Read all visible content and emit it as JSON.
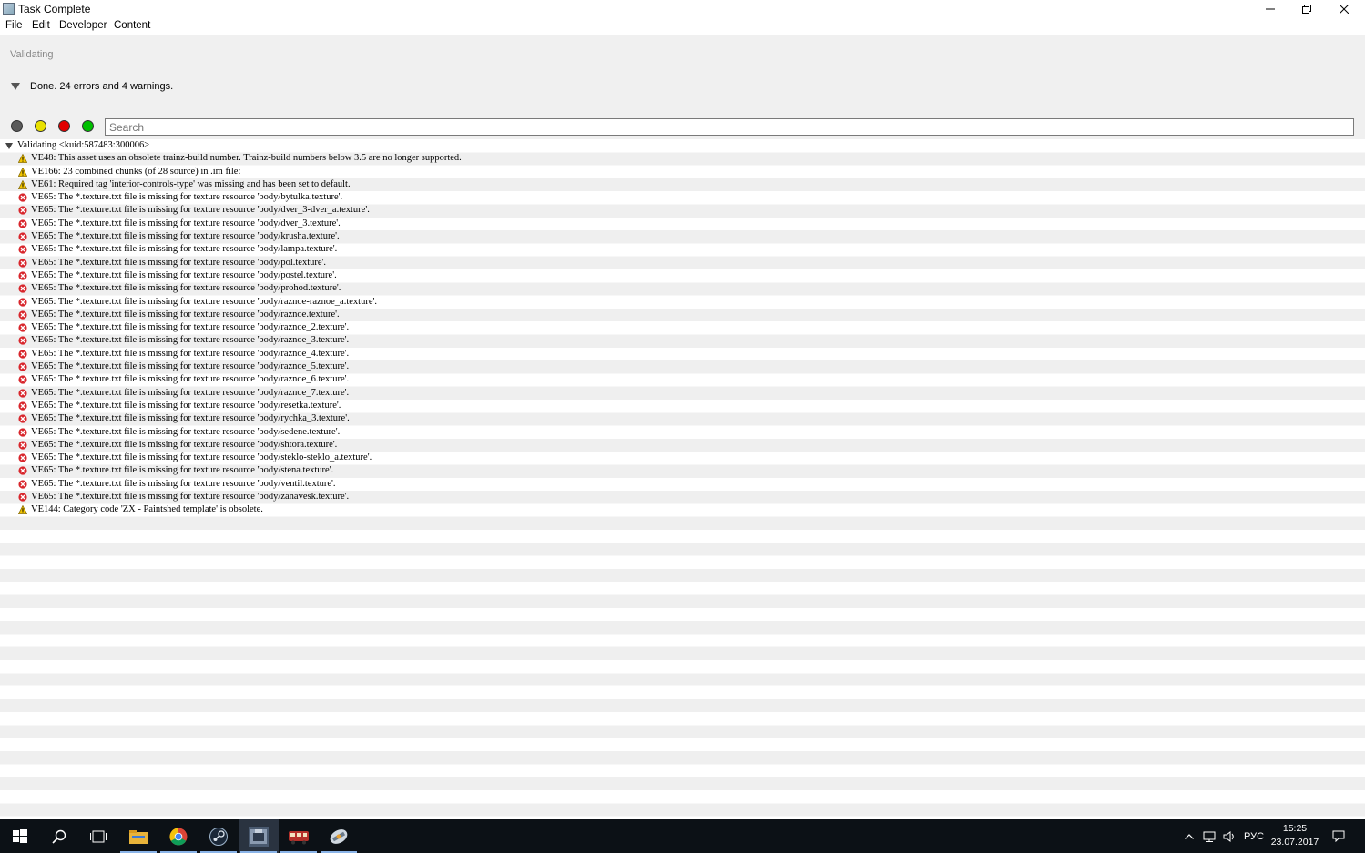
{
  "window": {
    "title": "Task Complete"
  },
  "menu": [
    "File",
    "Edit",
    "Developer",
    "Content"
  ],
  "panel": {
    "status": "Validating",
    "summary": "Done. 24 errors and 4 warnings."
  },
  "filters": [
    {
      "name": "all",
      "color": "#5a5a5a"
    },
    {
      "name": "warnings",
      "color": "#e8e000"
    },
    {
      "name": "errors",
      "color": "#e00000"
    },
    {
      "name": "ok",
      "color": "#00c000"
    }
  ],
  "search": {
    "placeholder": "Search"
  },
  "tree": {
    "root": "Validating <kuid:587483:300006>",
    "items": [
      {
        "level": "warning",
        "text": "VE48: This asset uses an obsolete trainz-build number. Trainz-build numbers below 3.5 are no longer supported."
      },
      {
        "level": "warning",
        "text": "VE166: 23 combined chunks (of 28 source) in .im file:"
      },
      {
        "level": "warning",
        "text": "VE61: Required tag 'interior-controls-type' was missing and has been set to default."
      },
      {
        "level": "error",
        "text": "VE65: The *.texture.txt file is missing for texture resource 'body/bytulka.texture'."
      },
      {
        "level": "error",
        "text": "VE65: The *.texture.txt file is missing for texture resource 'body/dver_3-dver_a.texture'."
      },
      {
        "level": "error",
        "text": "VE65: The *.texture.txt file is missing for texture resource 'body/dver_3.texture'."
      },
      {
        "level": "error",
        "text": "VE65: The *.texture.txt file is missing for texture resource 'body/krusha.texture'."
      },
      {
        "level": "error",
        "text": "VE65: The *.texture.txt file is missing for texture resource 'body/lampa.texture'."
      },
      {
        "level": "error",
        "text": "VE65: The *.texture.txt file is missing for texture resource 'body/pol.texture'."
      },
      {
        "level": "error",
        "text": "VE65: The *.texture.txt file is missing for texture resource 'body/postel.texture'."
      },
      {
        "level": "error",
        "text": "VE65: The *.texture.txt file is missing for texture resource 'body/prohod.texture'."
      },
      {
        "level": "error",
        "text": "VE65: The *.texture.txt file is missing for texture resource 'body/raznoe-raznoe_a.texture'."
      },
      {
        "level": "error",
        "text": "VE65: The *.texture.txt file is missing for texture resource 'body/raznoe.texture'."
      },
      {
        "level": "error",
        "text": "VE65: The *.texture.txt file is missing for texture resource 'body/raznoe_2.texture'."
      },
      {
        "level": "error",
        "text": "VE65: The *.texture.txt file is missing for texture resource 'body/raznoe_3.texture'."
      },
      {
        "level": "error",
        "text": "VE65: The *.texture.txt file is missing for texture resource 'body/raznoe_4.texture'."
      },
      {
        "level": "error",
        "text": "VE65: The *.texture.txt file is missing for texture resource 'body/raznoe_5.texture'."
      },
      {
        "level": "error",
        "text": "VE65: The *.texture.txt file is missing for texture resource 'body/raznoe_6.texture'."
      },
      {
        "level": "error",
        "text": "VE65: The *.texture.txt file is missing for texture resource 'body/raznoe_7.texture'."
      },
      {
        "level": "error",
        "text": "VE65: The *.texture.txt file is missing for texture resource 'body/resetka.texture'."
      },
      {
        "level": "error",
        "text": "VE65: The *.texture.txt file is missing for texture resource 'body/rychka_3.texture'."
      },
      {
        "level": "error",
        "text": "VE65: The *.texture.txt file is missing for texture resource 'body/sedene.texture'."
      },
      {
        "level": "error",
        "text": "VE65: The *.texture.txt file is missing for texture resource 'body/shtora.texture'."
      },
      {
        "level": "error",
        "text": "VE65: The *.texture.txt file is missing for texture resource 'body/steklo-steklo_a.texture'."
      },
      {
        "level": "error",
        "text": "VE65: The *.texture.txt file is missing for texture resource 'body/stena.texture'."
      },
      {
        "level": "error",
        "text": "VE65: The *.texture.txt file is missing for texture resource 'body/ventil.texture'."
      },
      {
        "level": "error",
        "text": "VE65: The *.texture.txt file is missing for texture resource 'body/zanavesk.texture'."
      },
      {
        "level": "warning",
        "text": "VE144: Category code 'ZX - Paintshed template' is obsolete."
      }
    ]
  },
  "taskbar": {
    "apps": [
      {
        "name": "start-icon"
      },
      {
        "name": "search-icon"
      },
      {
        "name": "task-view-icon"
      },
      {
        "name": "file-explorer-icon"
      },
      {
        "name": "chrome-icon"
      },
      {
        "name": "steam-icon"
      },
      {
        "name": "trainz-content-manager-icon",
        "active": true
      },
      {
        "name": "trainz-icon"
      },
      {
        "name": "surveyor-icon"
      }
    ],
    "language": "РУС",
    "time": "15:25",
    "date": "23.07.2017"
  }
}
